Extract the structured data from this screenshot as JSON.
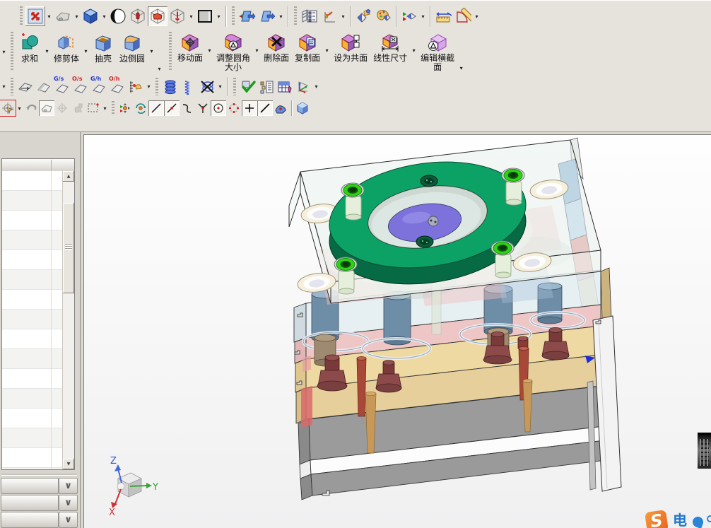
{
  "app": {
    "toolbar_bg": "#e6e3dd",
    "viewport_bg": "#fdfdfd",
    "panel_bg": "#d8d5cf"
  },
  "ui": {
    "dropdown": "▾",
    "scroll_up": "▲",
    "scroll_down": "▼",
    "collapse_chevron": "∨"
  },
  "toolbar_view": {
    "icons": [
      "fit-view",
      "shaded-with-edges",
      "isometric-orientation",
      "rendering-style",
      "wireframe-with-dim-edges",
      "shaded",
      "static-wireframe",
      "background-swatch",
      "edit-section",
      "new-section",
      "layer-settings",
      "wcs-dynamics",
      "show-and-hide",
      "edit-object-display",
      "class-selection",
      "measure-distance",
      "measure-angle"
    ]
  },
  "toolbar_feature": {
    "buttons": [
      {
        "line1": "求和",
        "line2": ""
      },
      {
        "line1": "修剪体",
        "line2": ""
      },
      {
        "line1": "抽壳",
        "line2": ""
      },
      {
        "line1": "边倒圆",
        "line2": ""
      },
      {
        "line1": "移动面",
        "line2": ""
      },
      {
        "line1": "调整圆角",
        "line2": "大小"
      },
      {
        "line1": "删除面",
        "line2": ""
      },
      {
        "line1": "复制面",
        "line2": ""
      },
      {
        "line1": "设为共面",
        "line2": ""
      },
      {
        "line1": "线性尺寸",
        "line2": ""
      },
      {
        "line1": "编辑横截",
        "line2": "面"
      }
    ]
  },
  "toolbar_analysis": {
    "badges": [
      {
        "label": "G/s",
        "color": "#2233cc"
      },
      {
        "label": "O/s",
        "color": "#cc2222"
      },
      {
        "label": "G/h",
        "color": "#2233cc"
      },
      {
        "label": "O/h",
        "color": "#cc2222"
      }
    ],
    "icons": [
      "draft-analysis",
      "face-analysis",
      "gs-draft-check",
      "os-draft-check",
      "gh-draft-check",
      "oh-draft-check",
      "information-window",
      "thread",
      "spring-tool",
      "suppress-feature",
      "examine-geometry",
      "feature-browser",
      "expression-table",
      "orient-wcs"
    ]
  },
  "toolbar_snap": {
    "icons": [
      "selection-filter",
      "undo",
      "shaded-preview",
      "deselect-all",
      "pick-filter",
      "rectangle-select",
      "snap-point",
      "rotate-point",
      "end-point",
      "point-on-line",
      "mid-point",
      "tangent-point",
      "intersection-point",
      "arc-center",
      "quadrant-point",
      "existing-point",
      "point-on-curve",
      "point-on-face",
      "shaded-cube"
    ]
  },
  "navigator": {
    "visible_rows": 15,
    "collapsed_panel_count": 3
  },
  "viewport": {
    "triad": {
      "x": "X",
      "y": "Y",
      "z": "Z"
    },
    "watermark": {
      "logo": "S",
      "text": "电"
    }
  },
  "model": {
    "palette": {
      "locating_ring_top": "#0CA266",
      "locating_ring_side": "#066A45",
      "sprue_bushing": "#7D72DC",
      "corner_screw": "#2ED512",
      "top_plate_glass": "#E9F3EE",
      "plate_tan": "#EED9A2",
      "plate_pink": "#EEC6C6",
      "guide_pillar_blue": "#6E8DA6",
      "bushing_maroon": "#8D4A4A",
      "ejector_pin_red": "#A84838",
      "support_pin_tan": "#C89858",
      "base_plate_gray": "#9B9B9B",
      "side_face_blue": "#8AB2D8",
      "side_face_pink": "#E29A9A"
    }
  }
}
